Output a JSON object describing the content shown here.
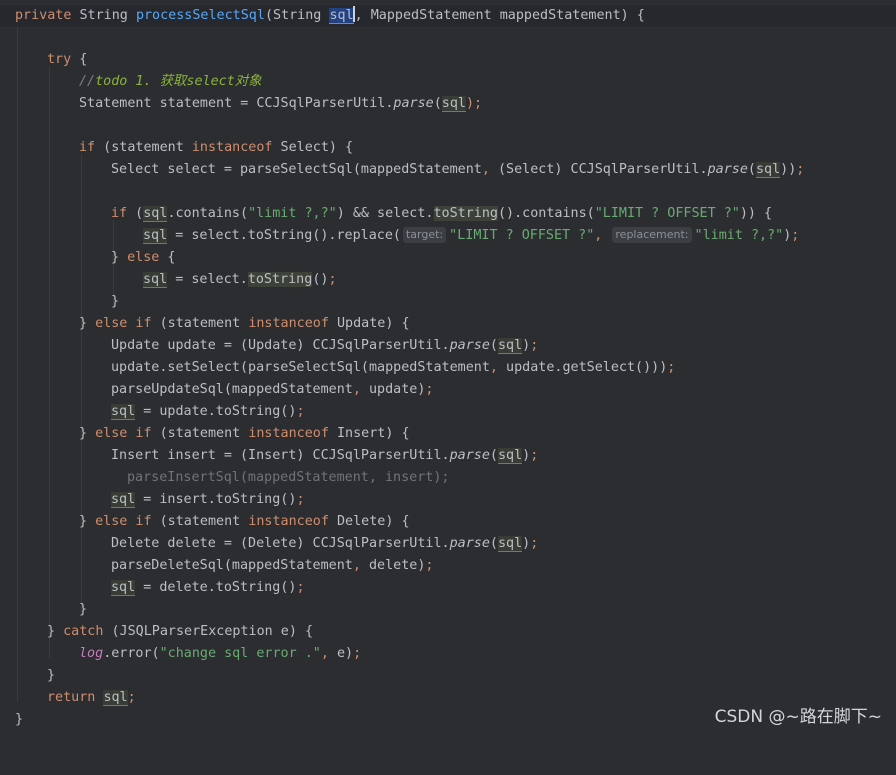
{
  "lines": [
    [
      "private",
      "String",
      "processSelectSql",
      "(String ",
      "sql",
      ", MappedStatement mappedStatement) {"
    ],
    [],
    [
      "try",
      " {"
    ],
    [
      "//",
      "todo 1. ",
      "获取",
      "select",
      "对象"
    ],
    [
      "Statement statement = CCJSqlParserUtil.",
      "parse",
      "(",
      "sql",
      ");"
    ],
    [],
    [
      "if",
      " (statement ",
      "instanceof",
      " Select) {"
    ],
    [
      "Select select = parseSelectSql(mappedStatement",
      ",",
      " (Select) CCJSqlParserUtil.",
      "parse",
      "(",
      "sql",
      "))",
      ";"
    ],
    [],
    [
      "if",
      " (",
      "sql",
      ".contains(",
      "\"limit ?,?\"",
      ") && select.",
      "toString",
      "().contains(",
      "\"LIMIT ? OFFSET ?\"",
      ")) {"
    ],
    [
      "sql",
      " = select.toString().replace(",
      "target:",
      "\"LIMIT ? OFFSET ?\"",
      ",",
      "replacement:",
      "\"limit ?,?\"",
      ")",
      ";"
    ],
    [
      "}",
      "else",
      " {"
    ],
    [
      "sql",
      " = select.",
      "toString",
      "()",
      ";"
    ],
    [
      "}"
    ],
    [
      "}",
      "else if",
      " (statement ",
      "instanceof",
      " Update) {"
    ],
    [
      "Update update = (Update) CCJSqlParserUtil.",
      "parse",
      "(",
      "sql",
      ")",
      ";"
    ],
    [
      "update.setSelect(parseSelectSql(mappedStatement",
      ",",
      " update.getSelect()))",
      ";"
    ],
    [
      "parseUpdateSql(mappedStatement",
      ",",
      " update)",
      ";"
    ],
    [
      "sql",
      " = update.toString()",
      ";"
    ],
    [
      "}",
      "else if",
      " (statement ",
      "instanceof",
      " Insert) {"
    ],
    [
      "Insert insert = (Insert) CCJSqlParserUtil.",
      "parse",
      "(",
      "sql",
      ")",
      ";"
    ],
    [
      "parseInsertSql(mappedStatement, insert);"
    ],
    [
      "sql",
      " = insert.toString()",
      ";"
    ],
    [
      "}",
      "else if",
      " (statement ",
      "instanceof",
      " Delete) {"
    ],
    [
      "Delete delete = (Delete) CCJSqlParserUtil.",
      "parse",
      "(",
      "sql",
      ")",
      ";"
    ],
    [
      "parseDeleteSql(mappedStatement",
      ",",
      " delete)",
      ";"
    ],
    [
      "sql",
      " = delete.toString()",
      ";"
    ],
    [
      "}"
    ],
    [
      "}",
      "catch",
      " (JSQLParserException e) {"
    ],
    [
      "log",
      ".error(",
      "\"change sql error .\"",
      ",",
      " e)",
      ";"
    ],
    [
      "}"
    ],
    [
      "return",
      "sql",
      ";"
    ],
    [
      "}"
    ]
  ],
  "watermark": "CSDN @~路在脚下~",
  "colors": {
    "background": "#2b2d30",
    "keyword": "#cf8e6d",
    "method_decl": "#56a8f5",
    "string": "#6aab73",
    "comment": "#7a7e85",
    "todo": "#8bb33d",
    "static_field": "#c77dbb"
  }
}
